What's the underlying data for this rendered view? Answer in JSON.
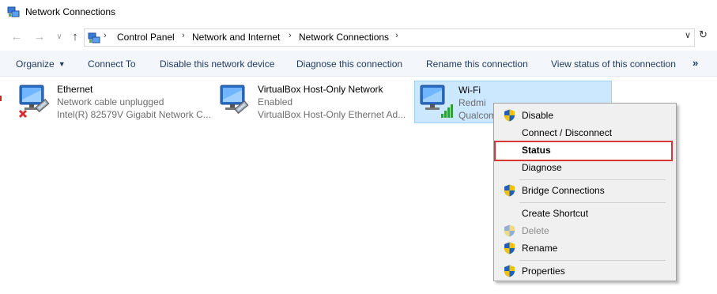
{
  "window": {
    "title": "Network Connections",
    "app_icon": "network-connections-icon"
  },
  "address_bar": {
    "breadcrumbs": [
      "Control Panel",
      "Network and Internet",
      "Network Connections"
    ],
    "separator": "›",
    "back_icon": "back-arrow-icon",
    "forward_icon": "forward-arrow-icon",
    "up_icon": "up-arrow-icon",
    "dropdown_icon": "chevron-down-icon",
    "refresh_icon": "refresh-icon"
  },
  "command_bar": {
    "organize": "Organize",
    "connect_to": "Connect To",
    "disable_device": "Disable this network device",
    "diagnose": "Diagnose this connection",
    "rename": "Rename this connection",
    "view_status": "View status of this connection",
    "more": "»"
  },
  "connections": [
    {
      "name": "Ethernet",
      "status": "Network cable unplugged",
      "device": "Intel(R) 82579V Gigabit Network C...",
      "icon": "ethernet-disconnected-icon"
    },
    {
      "name": "VirtualBox Host-Only Network",
      "status": "Enabled",
      "device": "VirtualBox Host-Only Ethernet Ad...",
      "icon": "ethernet-icon"
    },
    {
      "name": "Wi-Fi",
      "status": "Redmi",
      "device": "Qualcom",
      "icon": "wifi-signal-icon",
      "selected": true
    }
  ],
  "context_menu": {
    "items": [
      {
        "label": "Disable",
        "shield": true
      },
      {
        "label": "Connect / Disconnect",
        "shield": false
      },
      {
        "label": "Status",
        "shield": false,
        "bold": true,
        "highlighted": true
      },
      {
        "label": "Diagnose",
        "shield": false
      },
      {
        "label": "Bridge Connections",
        "shield": true
      },
      {
        "label": "Create Shortcut",
        "shield": false
      },
      {
        "label": "Delete",
        "shield": true,
        "disabled": true
      },
      {
        "label": "Rename",
        "shield": true
      },
      {
        "label": "Properties",
        "shield": true
      }
    ]
  },
  "colors": {
    "selection_bg": "#cce8ff",
    "highlight_border": "#d93636",
    "command_bar_bg": "#f3f6fb",
    "shield_blue": "#1f5fbf",
    "shield_yellow": "#f2c200"
  }
}
